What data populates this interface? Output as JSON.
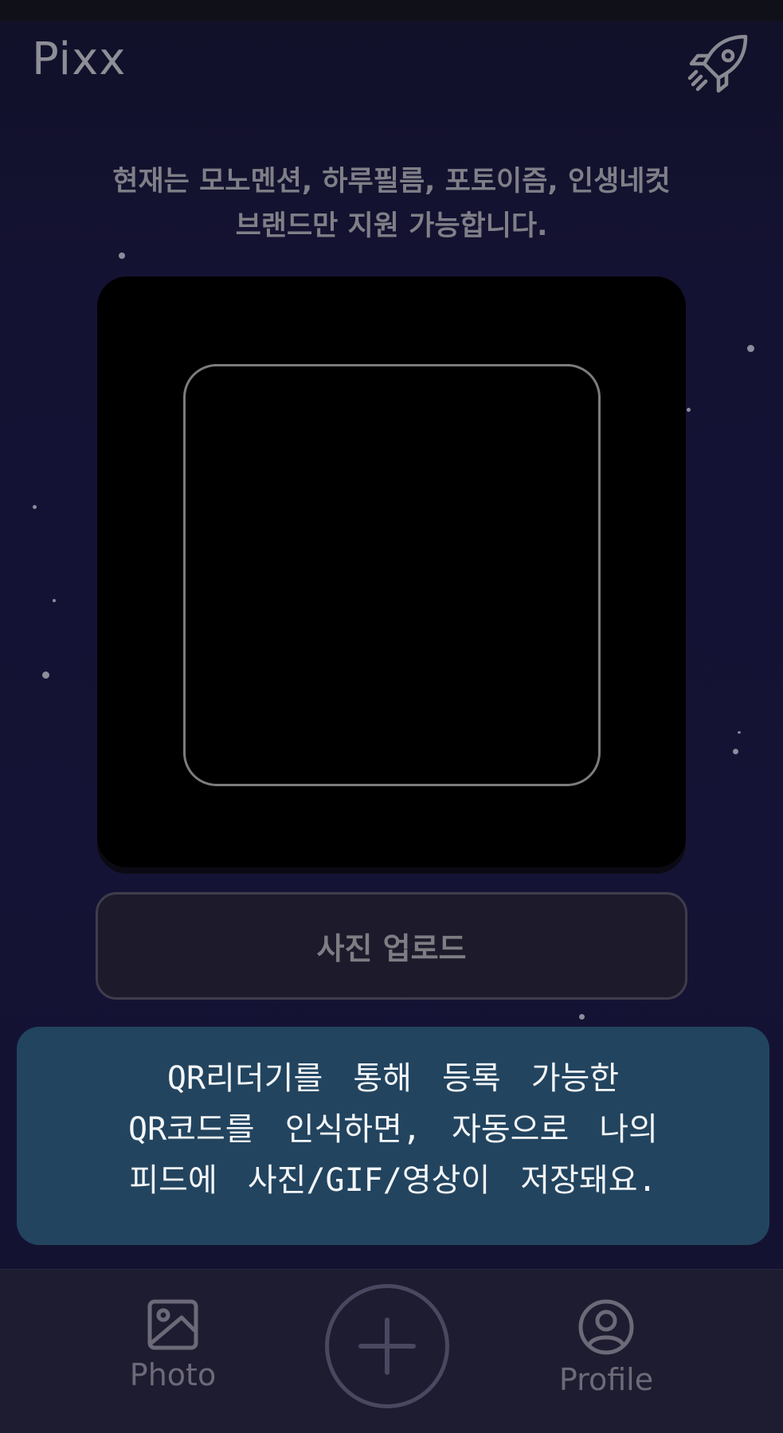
{
  "app": {
    "title": "Pixx"
  },
  "header": {
    "rocket_icon": "rocket-icon"
  },
  "notice": {
    "line1": "현재는 모노멘션, 하루필름, 포토이즘, 인생네컷",
    "line2": "브랜드만 지원 가능합니다."
  },
  "upload": {
    "label": "사진 업로드"
  },
  "toast": {
    "line1": "QR리더기를 통해 등록 가능한",
    "line2": "QR코드를 인식하면, 자동으로 나의",
    "line3": "피드에 사진/GIF/영상이 저장돼요."
  },
  "nav": {
    "photo_label": "Photo",
    "photo_icon": "image-icon",
    "add_icon": "plus-icon",
    "profile_label": "Profile",
    "profile_icon": "user-circle-icon"
  },
  "colors": {
    "background": "#141233",
    "toast": "#22445f",
    "nav": "#1e1c30",
    "muted_text": "#7f7f88"
  }
}
